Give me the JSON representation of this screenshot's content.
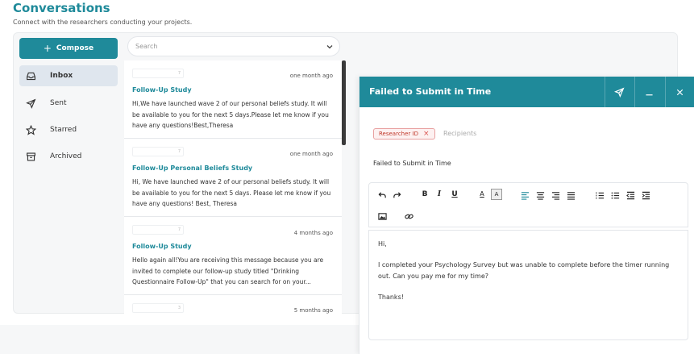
{
  "header": {
    "title": "Conversations",
    "subtitle": "Connect with the researchers conducting your projects."
  },
  "sidebar": {
    "compose_label": "Compose",
    "items": [
      {
        "label": "Inbox",
        "icon": "inbox-icon",
        "active": true
      },
      {
        "label": "Sent",
        "icon": "send-icon",
        "active": false
      },
      {
        "label": "Starred",
        "icon": "star-icon",
        "active": false
      },
      {
        "label": "Archived",
        "icon": "archive-icon",
        "active": false
      }
    ]
  },
  "search": {
    "placeholder": "Search"
  },
  "messages": [
    {
      "sender": "7",
      "time": "one month ago",
      "subject": "Follow-Up Study",
      "preview": "Hi,We have launched wave 2 of our personal beliefs study. It will be available to you for the next 5 days.Please let me know if you have any questions!Best,Theresa"
    },
    {
      "sender": "7",
      "time": "one month ago",
      "subject": "Follow-Up Personal Beliefs Study",
      "preview": "Hi, We have launched wave 2 of our personal beliefs study. It will be available to you for the next 5 days. Please let me know if you have any questions! Best, Theresa"
    },
    {
      "sender": "7",
      "time": "4 months ago",
      "subject": "Follow-Up Study",
      "preview": "Hello again all!You are receiving this message because you are invited to complete our follow-up study titled \"Drinking Questionnaire Follow-Up\" that you can search for on your..."
    },
    {
      "sender": "3",
      "time": "5 months ago",
      "subject": "",
      "preview": ""
    }
  ],
  "composer": {
    "title": "Failed to Submit in Time",
    "chip_label": "Researcher ID",
    "recipients_placeholder": "Recipients",
    "subject": "Failed to Submit in Time",
    "body": [
      "Hi,",
      "I completed your Psychology Survey but was unable to complete before the timer running out. Can you pay me for my time?",
      "Thanks!"
    ],
    "toolbar": {
      "bold": "B",
      "italic": "I",
      "underline": "U",
      "font_color": "A",
      "highlight": "A"
    }
  },
  "colors": {
    "accent": "#1f8a9a",
    "active_nav": "#dfe6ee",
    "chip_red": "#c0392b"
  }
}
